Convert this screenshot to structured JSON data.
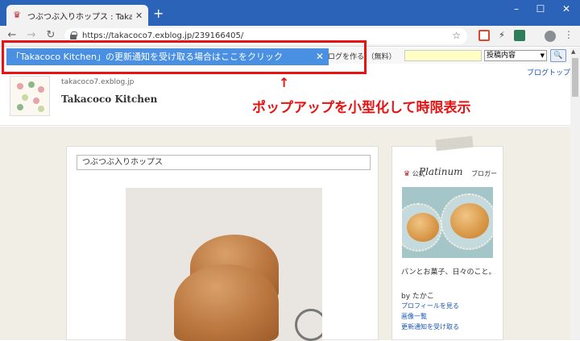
{
  "browser": {
    "tab_title": "つぶつぶ入りホップス : Takacoco Kitchen",
    "new_tab": "+",
    "url": "https://takacoco7.exblog.jp/239166405/",
    "window_controls": [
      "–",
      "☐",
      "✕"
    ]
  },
  "blogbar": {
    "create_text": "ログを作る!（無料）",
    "search_value": "",
    "select_value": "投稿内容",
    "search_button": "🔍"
  },
  "popup": {
    "message": "「Takacoco Kitchen」の更新通知を受け取る場合はここをクリック",
    "close": "✕"
  },
  "header": {
    "domain": "takacoco7.exblog.jp",
    "title": "Takacoco Kitchen",
    "blogtop_link": "ブログトップ"
  },
  "annotation": {
    "arrow": "↑",
    "text": "ポップアップを小型化して時限表示"
  },
  "post": {
    "title": "つぶつぶ入りホップス"
  },
  "sidebar": {
    "badge_official": "公式",
    "badge_title": "Platinum",
    "badge_sub": "ブロガー",
    "description": "パンとお菓子、日々のこと。",
    "by": "by たかこ",
    "links": [
      "プロフィールを見る",
      "画像一覧",
      "更新通知を受け取る"
    ]
  },
  "colors": {
    "chrome_bar": "#2a63b8",
    "popup_bg": "#4a90e2",
    "annotation": "#e81212",
    "link": "#1a56b5"
  }
}
